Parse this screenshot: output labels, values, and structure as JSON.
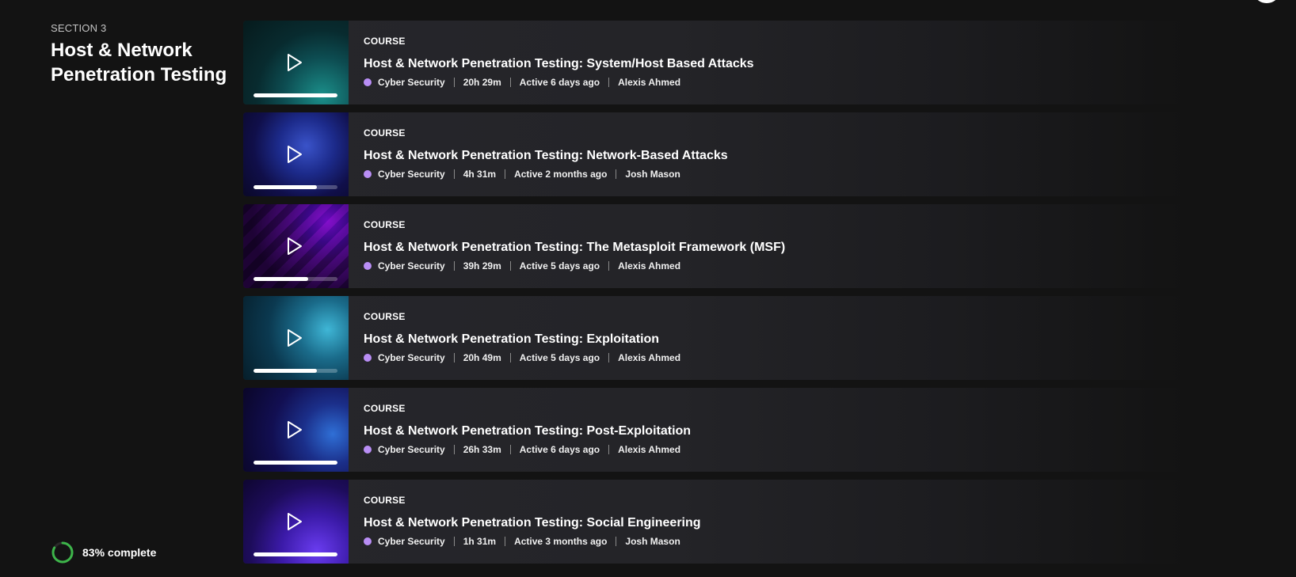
{
  "section": {
    "label": "SECTION 3",
    "title": "Host & Network Penetration Testing"
  },
  "progress": {
    "label": "83% complete",
    "percent": 83
  },
  "colors": {
    "category_dot": "#b98ef5",
    "progress_ring": "#3db54a",
    "background": "#131313"
  },
  "courses": [
    {
      "type": "COURSE",
      "title": "Host & Network Penetration Testing: System/Host Based Attacks",
      "category": "Cyber Security",
      "duration": "20h 29m",
      "activity": "Active 6 days ago",
      "author": "Alexis Ahmed",
      "progress": 100,
      "thumb_icon": "play-icon"
    },
    {
      "type": "COURSE",
      "title": "Host & Network Penetration Testing: Network-Based Attacks",
      "category": "Cyber Security",
      "duration": "4h 31m",
      "activity": "Active 2 months ago",
      "author": "Josh Mason",
      "progress": 75,
      "thumb_icon": "play-icon"
    },
    {
      "type": "COURSE",
      "title": "Host & Network Penetration Testing: The Metasploit Framework (MSF)",
      "category": "Cyber Security",
      "duration": "39h 29m",
      "activity": "Active 5 days ago",
      "author": "Alexis Ahmed",
      "progress": 65,
      "thumb_icon": "play-icon"
    },
    {
      "type": "COURSE",
      "title": "Host & Network Penetration Testing: Exploitation",
      "category": "Cyber Security",
      "duration": "20h 49m",
      "activity": "Active 5 days ago",
      "author": "Alexis Ahmed",
      "progress": 75,
      "thumb_icon": "play-icon"
    },
    {
      "type": "COURSE",
      "title": "Host & Network Penetration Testing: Post-Exploitation",
      "category": "Cyber Security",
      "duration": "26h 33m",
      "activity": "Active 6 days ago",
      "author": "Alexis Ahmed",
      "progress": 100,
      "thumb_icon": "play-icon"
    },
    {
      "type": "COURSE",
      "title": "Host & Network Penetration Testing: Social Engineering",
      "category": "Cyber Security",
      "duration": "1h 31m",
      "activity": "Active 3 months ago",
      "author": "Josh Mason",
      "progress": 100,
      "thumb_icon": "play-icon"
    }
  ]
}
